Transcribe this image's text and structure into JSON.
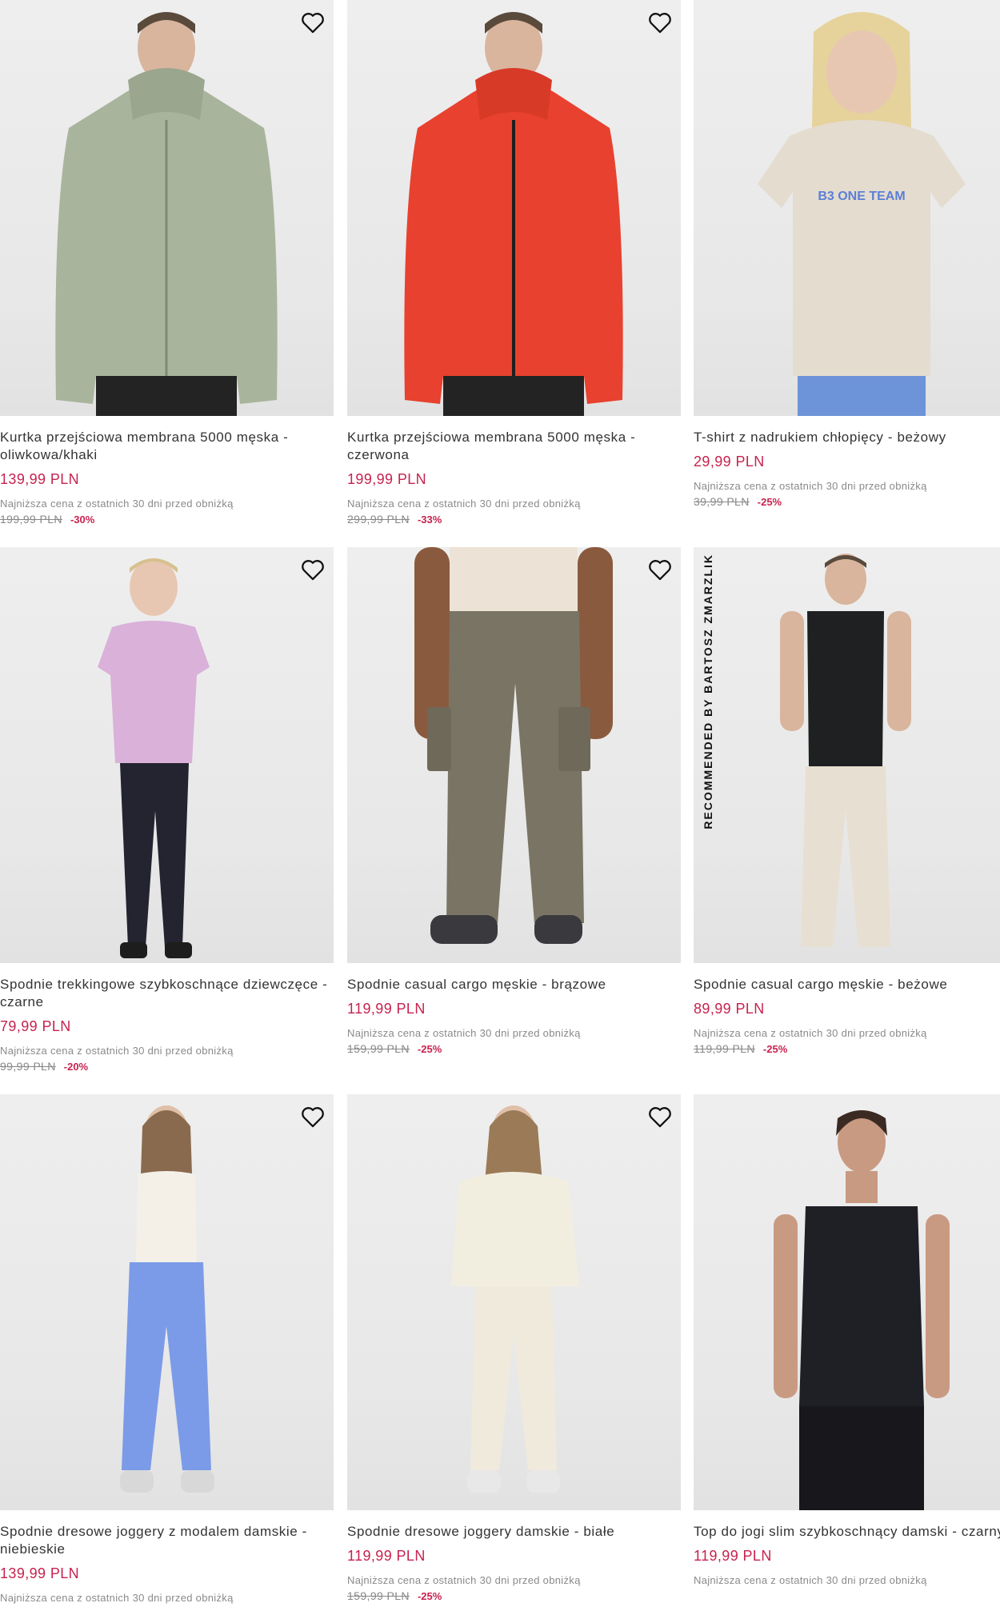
{
  "lowest_price_note": "Najniższa cena z ostatnich 30 dni przed obniżką",
  "colors": {
    "price": "#c7224f",
    "text": "#333333",
    "muted": "#8a8a8a"
  },
  "icons": {
    "wishlist": "heart-outline-icon"
  },
  "products": [
    {
      "title": "Kurtka przejściowa membrana 5000 męska - oliwkowa/khaki",
      "price": "139,99 PLN",
      "old_price": "199,99 PLN",
      "discount": "-30%",
      "badge": ""
    },
    {
      "title": "Kurtka przejściowa membrana 5000 męska - czerwona",
      "price": "199,99 PLN",
      "old_price": "299,99 PLN",
      "discount": "-33%",
      "badge": ""
    },
    {
      "title": "T-shirt z nadrukiem chłopięcy - beżowy",
      "price": "29,99 PLN",
      "old_price": "39,99 PLN",
      "discount": "-25%",
      "badge": "",
      "print": "B3 ONE TEAM"
    },
    {
      "title": "Spodnie trekkingowe szybkoschnące dziewczęce - czarne",
      "price": "79,99 PLN",
      "old_price": "99,99 PLN",
      "discount": "-20%",
      "badge": ""
    },
    {
      "title": "Spodnie casual cargo męskie - brązowe",
      "price": "119,99 PLN",
      "old_price": "159,99 PLN",
      "discount": "-25%",
      "badge": ""
    },
    {
      "title": "Spodnie casual cargo męskie - beżowe",
      "price": "89,99 PLN",
      "old_price": "119,99 PLN",
      "discount": "-25%",
      "badge": "RECOMMENDED BY BARTOSZ ZMARZLIK"
    },
    {
      "title": "Spodnie dresowe joggery z modalem damskie - niebieskie",
      "price": "139,99 PLN",
      "old_price": "",
      "discount": "",
      "badge": ""
    },
    {
      "title": "Spodnie dresowe joggery damskie - białe",
      "price": "119,99 PLN",
      "old_price": "159,99 PLN",
      "discount": "-25%",
      "badge": ""
    },
    {
      "title": "Top do jogi slim szybkoschnący damski - czarny",
      "price": "119,99 PLN",
      "old_price": "",
      "discount": "",
      "badge": ""
    }
  ]
}
